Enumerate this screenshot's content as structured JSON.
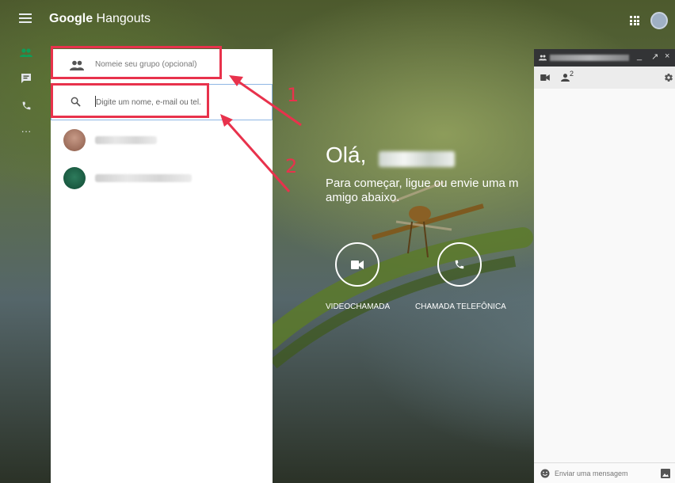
{
  "app": {
    "brand_bold": "Google",
    "brand_light": " Hangouts"
  },
  "rail": {
    "items": [
      "people-icon",
      "message-icon",
      "phone-icon",
      "more-icon"
    ],
    "more_label": "···"
  },
  "new_conversation": {
    "group_name_placeholder": "Nomeie seu grupo (opcional)",
    "search_placeholder": "Digite um nome, e-mail ou tel."
  },
  "annotations": {
    "one": "1",
    "two": "2",
    "color": "#e8324c"
  },
  "welcome": {
    "greeting": "Olá,",
    "intro_line1": "Para começar, ligue ou envie uma m",
    "intro_line2": "amigo abaixo.",
    "actions": [
      {
        "label": "VIDEOCHAMADA",
        "icon": "video-icon"
      },
      {
        "label": "CHAMADA TELEFÔNICA",
        "icon": "phone-icon"
      }
    ]
  },
  "chat": {
    "participants_count": "2",
    "minimize": "_",
    "popout": "↗",
    "close": "×",
    "message_placeholder": "Enviar uma mensagem"
  },
  "colors": {
    "accent_green": "#0f9d58",
    "chat_header": "#333436"
  }
}
